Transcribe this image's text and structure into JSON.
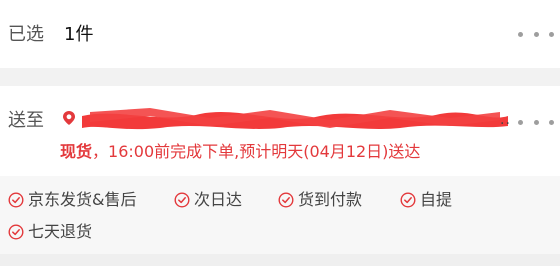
{
  "selected": {
    "label": "已选",
    "value": "1件"
  },
  "delivery": {
    "label": "送至",
    "address_redacted": "",
    "ellipsis": "..",
    "stock_status": "现货",
    "eta_text": "，16:00前完成下单,预计明天(04月12日)送达"
  },
  "services": [
    {
      "label": "京东发货&售后"
    },
    {
      "label": "次日达"
    },
    {
      "label": "货到付款"
    },
    {
      "label": "自提"
    },
    {
      "label": "七天退货"
    }
  ],
  "colors": {
    "accent": "#e3393c",
    "divider": "#f2f2f2",
    "services_bg": "#f7f7f7"
  },
  "icons": {
    "more": "more-dots-icon",
    "location": "location-pin-icon",
    "service_check": "circle-check-icon"
  }
}
